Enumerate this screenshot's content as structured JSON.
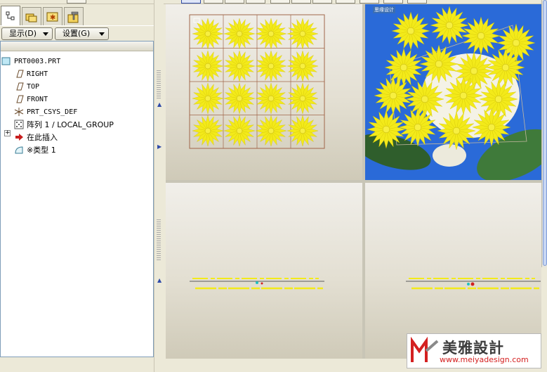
{
  "left_panel": {
    "tabs": [
      {
        "name": "model-tree",
        "icon": "model-tree-icon",
        "active": true
      },
      {
        "name": "folder-browser",
        "icon": "folders-icon",
        "active": false
      },
      {
        "name": "favorites",
        "icon": "favorites-icon",
        "active": false
      },
      {
        "name": "connections",
        "icon": "hammer-folder-icon",
        "active": false
      }
    ],
    "show_button": "显示(D)",
    "settings_button": "设置(G)"
  },
  "tree": {
    "items": [
      {
        "label": "PRT0003.PRT",
        "icon": "part-icon"
      },
      {
        "label": "RIGHT",
        "icon": "datum-plane-icon"
      },
      {
        "label": "TOP",
        "icon": "datum-plane-icon"
      },
      {
        "label": "FRONT",
        "icon": "datum-plane-icon"
      },
      {
        "label": "PRT_CSYS_DEF",
        "icon": "csys-icon"
      },
      {
        "label": "阵列 1 / LOCAL_GROUP",
        "icon": "pattern-icon"
      },
      {
        "label": "在此插入",
        "icon": "insert-arrow-icon"
      },
      {
        "label": "※类型 1",
        "icon": "type-feature-icon"
      }
    ]
  },
  "viewports": {
    "top_left": {
      "view": "flower-pattern-front"
    },
    "top_right": {
      "view": "photo-composite",
      "watermark": "思缘设计"
    },
    "bottom_left": {
      "view": "edge-view"
    },
    "bottom_right": {
      "view": "edge-view"
    }
  },
  "logo": {
    "brand": "美雅設計",
    "url": "www.meiyadesign.com"
  },
  "colors": {
    "flower": "#f3ea1a",
    "grid": "#a0664a",
    "sky": "#2a6ad8"
  }
}
